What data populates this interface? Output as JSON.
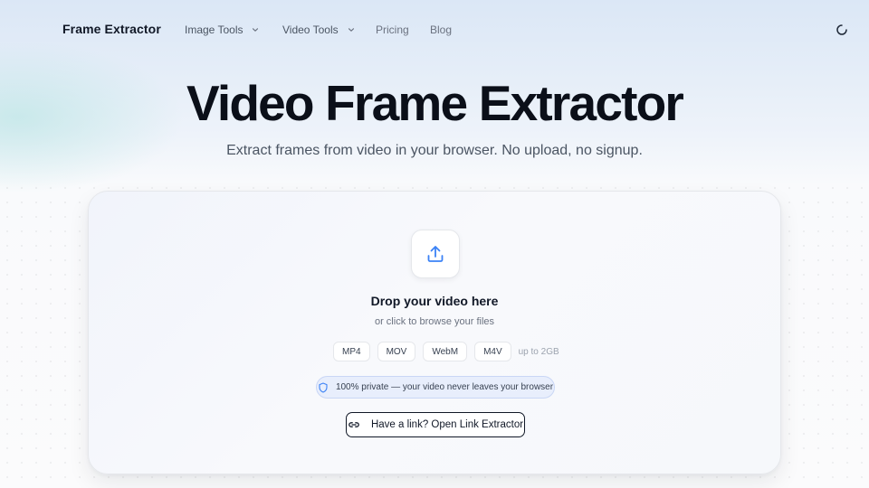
{
  "nav": {
    "brand": "Frame Extractor",
    "items": [
      {
        "label": "Image Tools",
        "has_dropdown": true
      },
      {
        "label": "Video Tools",
        "has_dropdown": true
      },
      {
        "label": "Pricing",
        "has_dropdown": false
      },
      {
        "label": "Blog",
        "has_dropdown": false
      }
    ],
    "status_icon": "loading-spinner-icon"
  },
  "hero": {
    "title": "Video Frame Extractor",
    "subtitle": "Extract frames from video in your browser. No upload, no signup."
  },
  "dropzone": {
    "icon": "upload-icon",
    "title": "Drop your video here",
    "subtitle": "or click to browse your files",
    "formats": [
      "MP4",
      "MOV",
      "WebM",
      "M4V"
    ],
    "size_note": "up to 2GB",
    "privacy_icon": "shield-icon",
    "privacy_text": "100% private — your video never leaves your browser",
    "link_icon": "link-icon",
    "link_button": "Have a link? Open Link Extractor"
  },
  "colors": {
    "accent": "#3b82f6",
    "text_primary": "#111827",
    "privacy_bg": "#e8eefc"
  }
}
